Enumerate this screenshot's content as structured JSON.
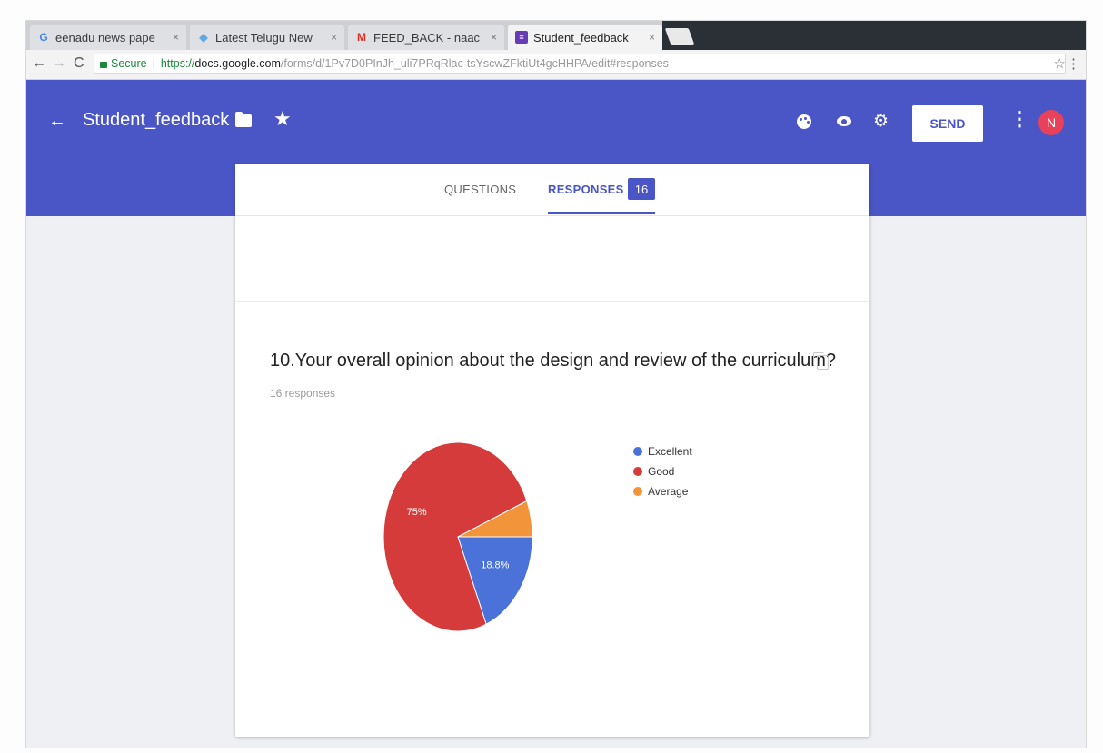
{
  "browser": {
    "tabs": [
      {
        "favicon": "google-icon",
        "title": "eenadu news pape"
      },
      {
        "favicon": "news-icon",
        "title": "Latest Telugu New"
      },
      {
        "favicon": "gmail-icon",
        "title": "FEED_BACK - naac"
      },
      {
        "favicon": "forms-icon",
        "title": "Student_feedback"
      }
    ],
    "security_label": "Secure",
    "url_protocol": "https://",
    "url_host": "docs.google.com",
    "url_path": "/forms/d/1Pv7D0PInJh_uli7PRqRlac-tsYscwZFktiUt4gcHHPA/edit#responses"
  },
  "header": {
    "form_title": "Student_feedback",
    "send_label": "SEND",
    "avatar_initial": "N"
  },
  "nav": {
    "questions_label": "QUESTIONS",
    "responses_label": "RESPONSES",
    "responses_count": "16"
  },
  "summary": {
    "question": "10.Your overall opinion about the design and review of the curriculum?",
    "responses_text": "16 responses"
  },
  "colors": {
    "accent": "#4a55c6",
    "excellent": "#4a72d8",
    "good": "#d63b3b",
    "average": "#f2943a"
  },
  "chart_data": {
    "type": "pie",
    "categories": [
      "Excellent",
      "Good",
      "Average"
    ],
    "values": [
      18.8,
      75,
      6.2
    ],
    "slice_labels": [
      "18.8%",
      "75%",
      ""
    ],
    "colors": [
      "#4a72d8",
      "#d63b3b",
      "#f2943a"
    ],
    "legend_position": "right"
  }
}
